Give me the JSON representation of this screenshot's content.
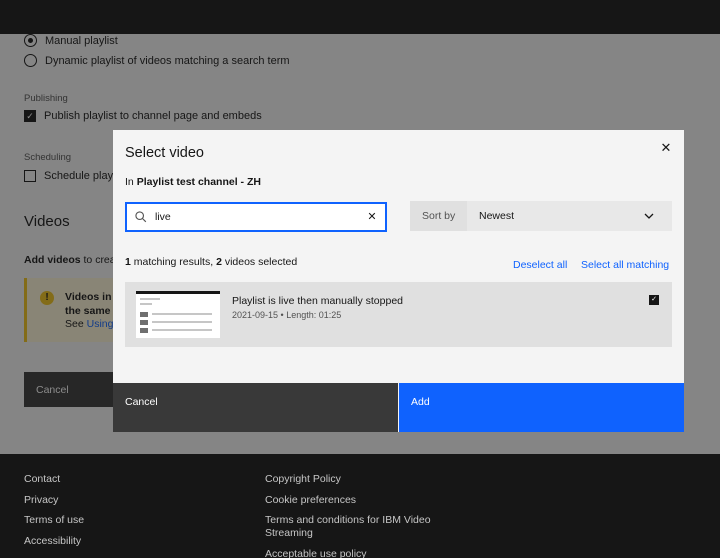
{
  "page": {
    "playlist_type": {
      "options": [
        "Manual playlist",
        "Dynamic playlist of videos matching a search term"
      ]
    },
    "publishing": {
      "label": "Publishing",
      "option": "Publish playlist to channel page and embeds"
    },
    "scheduling": {
      "label": "Scheduling",
      "option": "Schedule playl"
    },
    "videos_heading": "Videos",
    "add_videos": {
      "bold": "Add videos",
      "rest": "to crea"
    },
    "warning": {
      "line1": "Videos in",
      "line2": "the same",
      "line3_prefix": "See",
      "line3_link": "Using"
    },
    "cancel_label": "Cancel"
  },
  "footer": {
    "col1": [
      "Contact",
      "Privacy",
      "Terms of use",
      "Accessibility"
    ],
    "col2": [
      "Copyright Policy",
      "Cookie preferences",
      "Terms and conditions for IBM Video Streaming",
      "Acceptable use policy"
    ]
  },
  "modal": {
    "title": "Select video",
    "close_icon": "close-icon",
    "subtitle_prefix": "In",
    "channel": "Playlist test channel - ZH",
    "search": {
      "value": "live",
      "icon": "search-icon",
      "clear_icon": "clear-icon"
    },
    "sort": {
      "label": "Sort by",
      "value": "Newest"
    },
    "results": {
      "count": "1",
      "count_text": "matching results,",
      "selected": "2",
      "selected_text": "videos selected"
    },
    "deselect_all": "Deselect all",
    "select_all_matching": "Select all matching",
    "videos": [
      {
        "title": "Playlist is live then manually stopped",
        "meta": "2021-09-15 • Length: 01:25",
        "checked": true
      }
    ],
    "cancel_label": "Cancel",
    "add_label": "Add"
  },
  "colors": {
    "primary": "#0f62fe",
    "dark": "#161616",
    "warning": "#f1c21b"
  }
}
